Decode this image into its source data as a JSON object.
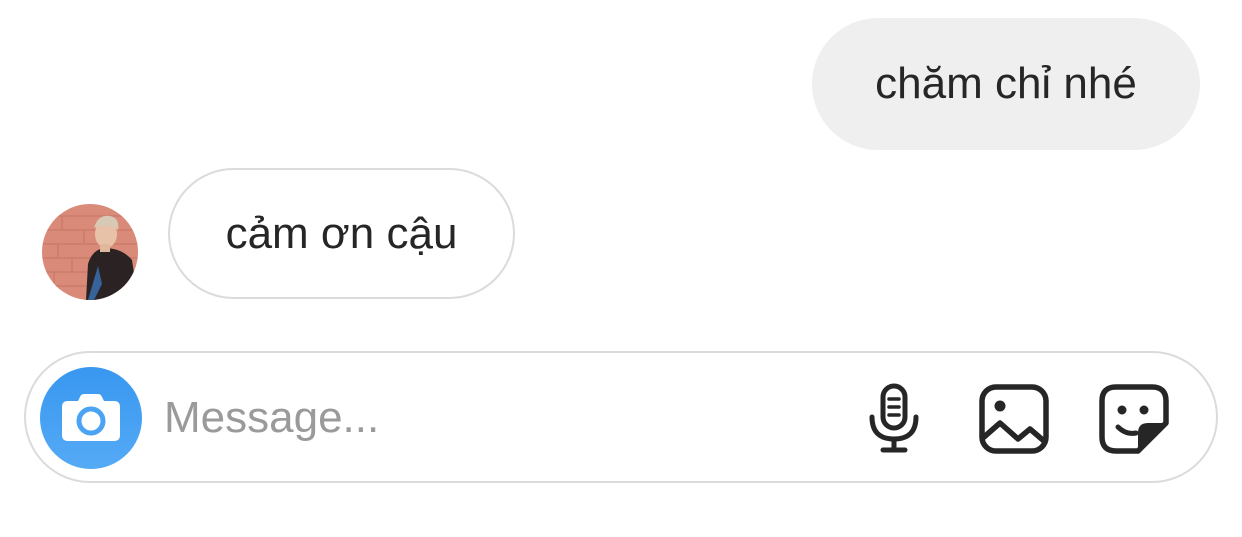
{
  "thread": {
    "messages": [
      {
        "direction": "sent",
        "text": "chăm chỉ nhé"
      },
      {
        "direction": "received",
        "text": "cảm ơn cậu"
      }
    ]
  },
  "composer": {
    "placeholder": "Message...",
    "value": "",
    "icons": {
      "camera": "camera-icon",
      "microphone": "microphone-icon",
      "gallery": "image-gallery-icon",
      "sticker": "sticker-icon"
    }
  },
  "colors": {
    "sent_bubble": "#efefef",
    "received_border": "#dbdbdb",
    "camera_button": "#3897f0",
    "text": "#262626",
    "placeholder": "#9a9a9a"
  }
}
